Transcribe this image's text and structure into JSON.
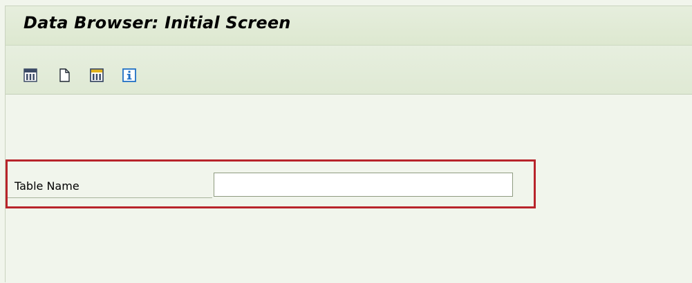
{
  "window": {
    "title": "Data Browser: Initial Screen"
  },
  "toolbar": {
    "buttons": [
      {
        "icon": "table-grid-icon"
      },
      {
        "icon": "blank-document-icon"
      },
      {
        "icon": "table-header-icon"
      },
      {
        "icon": "info-icon"
      }
    ]
  },
  "form": {
    "table_name": {
      "label": "Table Name",
      "value": "",
      "placeholder": ""
    }
  },
  "colors": {
    "background": "#f1f5ec",
    "highlight": "#b8242b",
    "icon_blue": "#1f6fc5",
    "icon_yellow": "#e1b21c"
  }
}
